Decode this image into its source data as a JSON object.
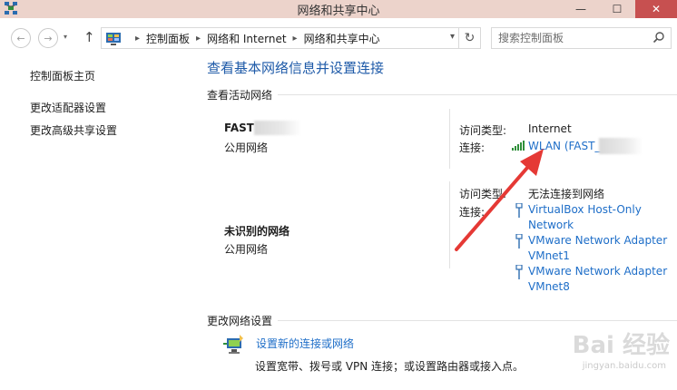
{
  "window": {
    "title": "网络和共享中心",
    "minimize_glyph": "—",
    "maximize_glyph": "☐",
    "close_glyph": "✕"
  },
  "nav": {
    "back_glyph": "←",
    "forward_glyph": "→",
    "dropdown_glyph": "▾",
    "up_glyph": "↑",
    "breadcrumbs": [
      "控制面板",
      "网络和 Internet",
      "网络和共享中心"
    ],
    "breadcrumb_sep": "▸",
    "address_dropdown_glyph": "▾",
    "refresh_glyph": "↻",
    "search_placeholder": "搜索控制面板"
  },
  "sidebar": {
    "items": [
      {
        "label": "控制面板主页"
      },
      {
        "label": "更改适配器设置"
      },
      {
        "label": "更改高级共享设置"
      }
    ]
  },
  "main": {
    "heading": "查看基本网络信息并设置连接",
    "active_networks_label": "查看活动网络",
    "network1": {
      "name": "FAST",
      "type": "公用网络",
      "access_type_label": "访问类型:",
      "access_type": "Internet",
      "connections_label": "连接:",
      "connection": "WLAN (FAST_"
    },
    "network2": {
      "name": "未识别的网络",
      "type": "公用网络",
      "access_type_label": "访问类型:",
      "access_type": "无法连接到网络",
      "connections_label": "连接:",
      "connections": [
        {
          "line1": "VirtualBox Host-Only",
          "line2": "Network"
        },
        {
          "line1": "VMware Network Adapter",
          "line2": "VMnet1"
        },
        {
          "line1": "VMware Network Adapter",
          "line2": "VMnet8"
        }
      ]
    },
    "change_settings_label": "更改网络设置",
    "new_connection_link": "设置新的连接或网络",
    "new_connection_desc": "设置宽带、拨号或 VPN 连接；或设置路由器或接入点。"
  },
  "colors": {
    "link": "#1e6ec8",
    "heading": "#1e5aa8",
    "titlebar": "#ecd3cb",
    "close": "#c75050",
    "annotation_arrow": "#e53935"
  },
  "watermark": {
    "text": "Bai 经验",
    "sub": "jingyan.baidu.com"
  }
}
